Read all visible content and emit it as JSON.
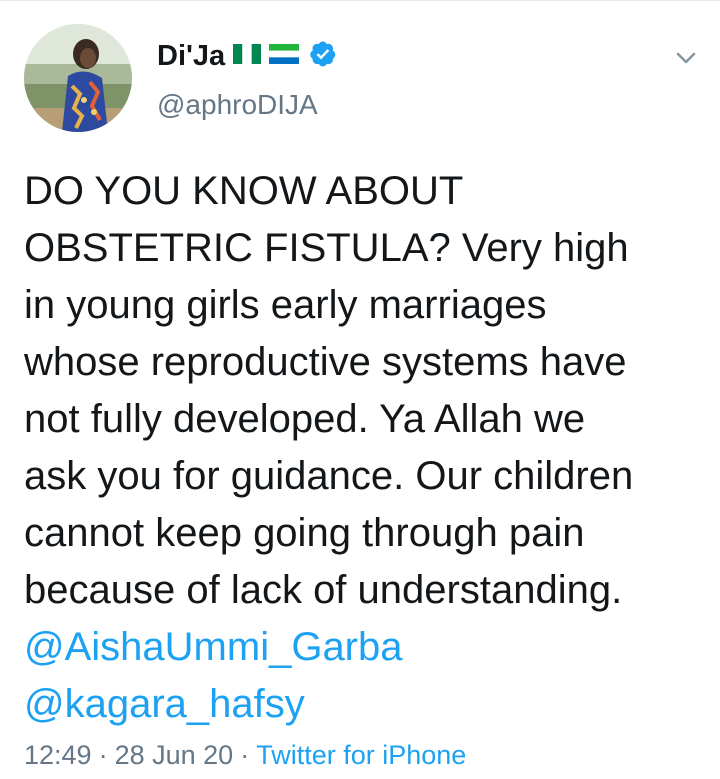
{
  "user": {
    "display_name": "Di'Ja",
    "handle": "@aphroDIJA",
    "verified": true,
    "flags": [
      "nigeria-flag",
      "sierra-leone-flag"
    ]
  },
  "tweet": {
    "lines": [
      "DO YOU KNOW ABOUT",
      "OBSTETRIC FISTULA? Very high",
      "in young girls early marriages",
      "whose reproductive systems have",
      "not fully developed. Ya Allah we",
      "ask you for guidance. Our children",
      "cannot keep going through pain",
      "because of lack of understanding."
    ],
    "mentions": [
      "@AishaUmmi_Garba",
      "@kagara_hafsy"
    ]
  },
  "meta": {
    "time": "12:49",
    "separator": "·",
    "date": "28 Jun 20",
    "source": "Twitter for iPhone"
  },
  "colors": {
    "text": "#14171a",
    "secondary": "#657786",
    "link": "#1da1f2",
    "verified_badge": "#1da1f2"
  },
  "icons": {
    "menu": "chevron-down-icon",
    "verified": "verified-badge-icon"
  }
}
